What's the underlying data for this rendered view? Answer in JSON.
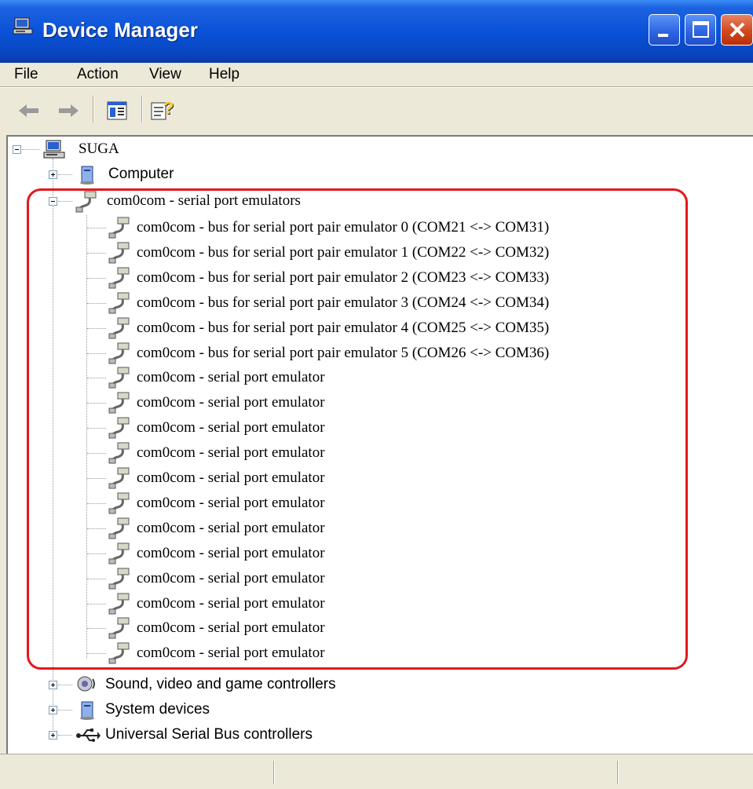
{
  "window": {
    "title": "Device Manager"
  },
  "menu": [
    "File",
    "Action",
    "View",
    "Help"
  ],
  "tree": {
    "root": "SUGA",
    "computer": "Computer",
    "group": "com0com - serial port emulators",
    "bus_items": [
      "com0com - bus for serial port pair emulator 0 (COM21 <-> COM31)",
      "com0com - bus for serial port pair emulator 1 (COM22 <-> COM32)",
      "com0com - bus for serial port pair emulator 2 (COM23 <-> COM33)",
      "com0com - bus for serial port pair emulator 3 (COM24 <-> COM34)",
      "com0com - bus for serial port pair emulator 4 (COM25 <-> COM35)",
      "com0com - bus for serial port pair emulator 5 (COM26 <-> COM36)"
    ],
    "emulator_items": [
      "com0com - serial port emulator",
      "com0com - serial port emulator",
      "com0com - serial port emulator",
      "com0com - serial port emulator",
      "com0com - serial port emulator",
      "com0com - serial port emulator",
      "com0com - serial port emulator",
      "com0com - serial port emulator",
      "com0com - serial port emulator",
      "com0com - serial port emulator",
      "com0com - serial port emulator",
      "com0com - serial port emulator"
    ],
    "sound": "Sound, video and game controllers",
    "system": "System devices",
    "usb": "Universal Serial Bus controllers"
  },
  "colors": {
    "titlebar": "#0a52d9",
    "highlight": "#e3191c",
    "chrome": "#ece9d8"
  }
}
